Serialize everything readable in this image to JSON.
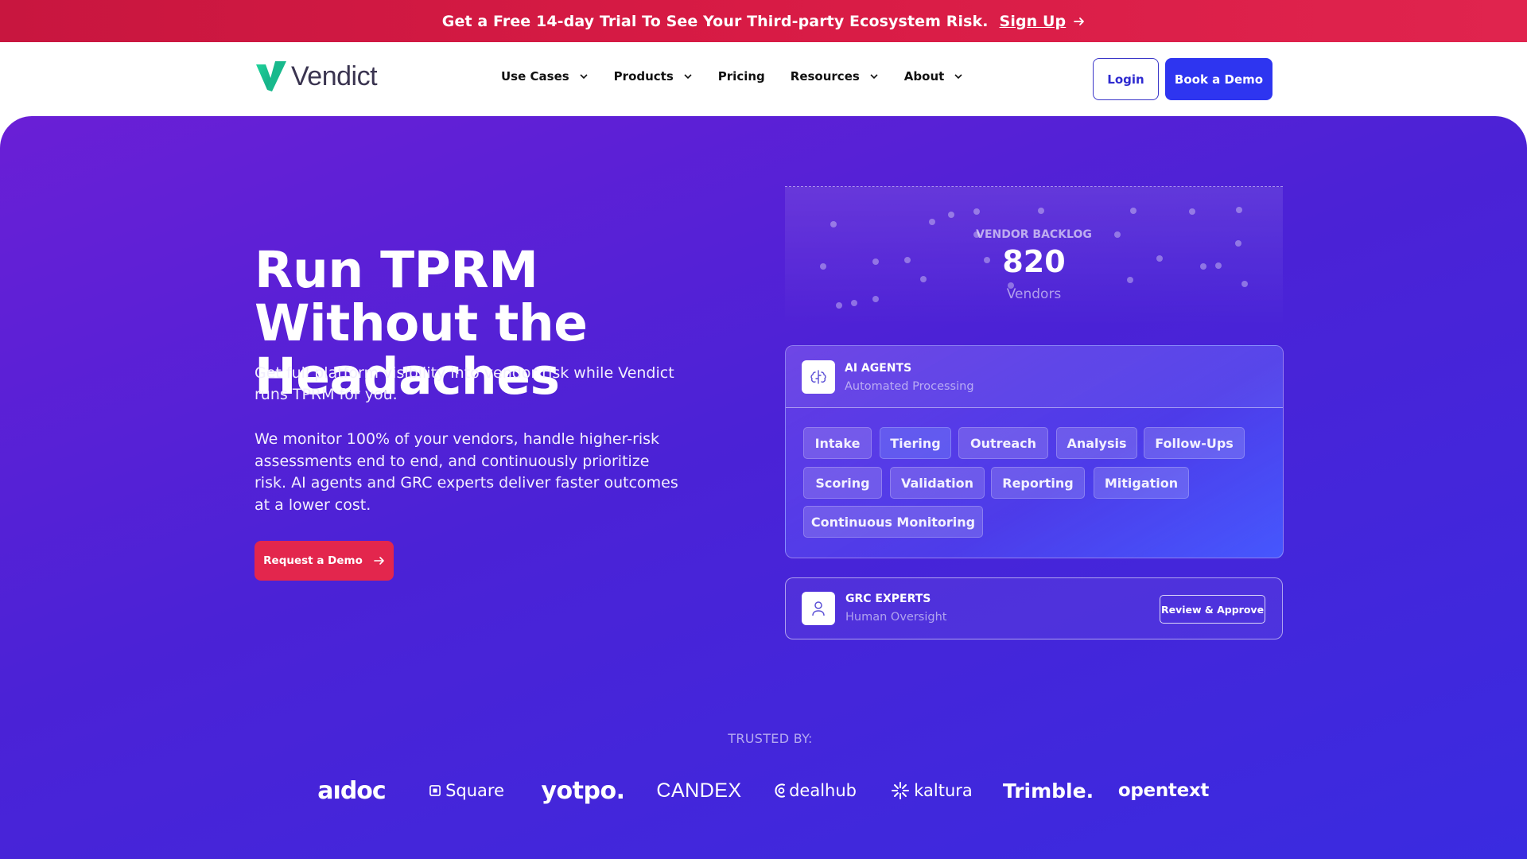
{
  "announcement": {
    "text": "Get a Free 14-day Trial To See Your Third-party Ecosystem Risk.",
    "link_label": "Sign Up"
  },
  "header": {
    "logo_text": "Vendict",
    "nav": [
      {
        "label": "Use Cases",
        "has_dropdown": true
      },
      {
        "label": "Products",
        "has_dropdown": true
      },
      {
        "label": "Pricing",
        "has_dropdown": false
      },
      {
        "label": "Resources",
        "has_dropdown": true
      },
      {
        "label": "About",
        "has_dropdown": true
      }
    ],
    "login_label": "Login",
    "demo_label": "Book a Demo"
  },
  "hero": {
    "title": "Run TPRM Without the Headaches",
    "subtitle": "Get full platform visibility into vendor risk while Vendict runs TPRM for you.",
    "body": "We monitor 100% of your vendors, handle higher-risk assessments end to end, and continuously prioritize risk. AI agents and GRC experts deliver faster outcomes at a lower cost.",
    "cta_label": "Request a Demo"
  },
  "backlog": {
    "label": "VENDOR BACKLOG",
    "value": "820",
    "unit": "Vendors"
  },
  "agents": {
    "title": "AI AGENTS",
    "subtitle": "Automated Processing",
    "chips": [
      "Intake",
      "Tiering",
      "Outreach",
      "Analysis",
      "Follow-Ups",
      "Scoring",
      "Validation",
      "Reporting",
      "Mitigation",
      "Continuous Monitoring"
    ]
  },
  "grc": {
    "title": "GRC EXPERTS",
    "subtitle": "Human Oversight",
    "action_label": "Review & Approve"
  },
  "trusted": {
    "label": "TRUSTED BY:",
    "brands": [
      "aıdoc",
      "Square",
      "yotpo.",
      "CANDEX",
      "dealhub",
      "kaltura",
      "Trimble.",
      "opentext"
    ]
  },
  "colors": {
    "announce_bg": "#d81b45",
    "primary_button": "#2e35f0",
    "cta_button": "#e3264d",
    "hero_gradient_start": "#6a1fd6",
    "hero_gradient_end": "#3a2be0"
  }
}
